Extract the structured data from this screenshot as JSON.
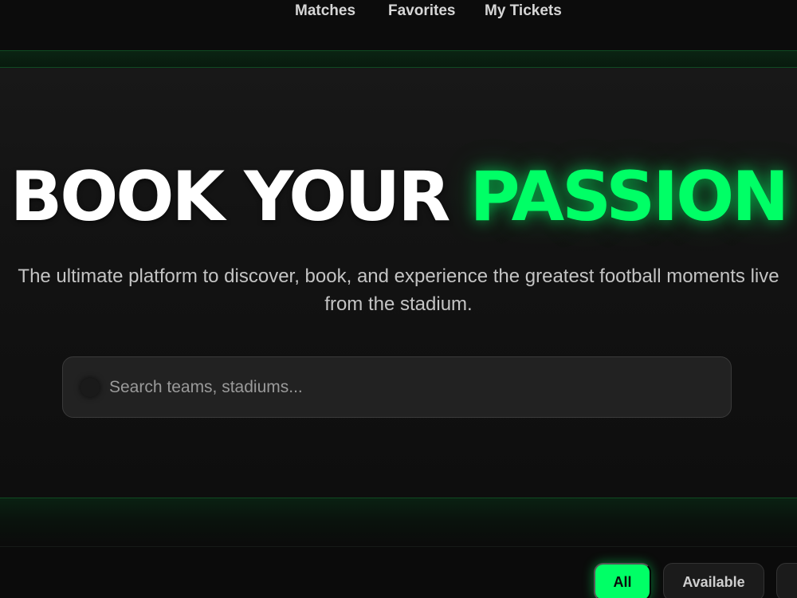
{
  "nav": {
    "matches": "Matches",
    "favorites": "Favorites",
    "tickets": "My Tickets"
  },
  "hero": {
    "title_white": "BOOK YOUR",
    "title_green": "PASSION",
    "subtitle": "The ultimate platform to discover, book, and experience the greatest football moments live from the stadium."
  },
  "search": {
    "icon": "search-icon",
    "placeholder": "Search teams, stadiums..."
  },
  "filters": {
    "all": "All",
    "available": "Available"
  },
  "colors": {
    "accent": "#00ff66",
    "background": "#0b0b0b"
  }
}
